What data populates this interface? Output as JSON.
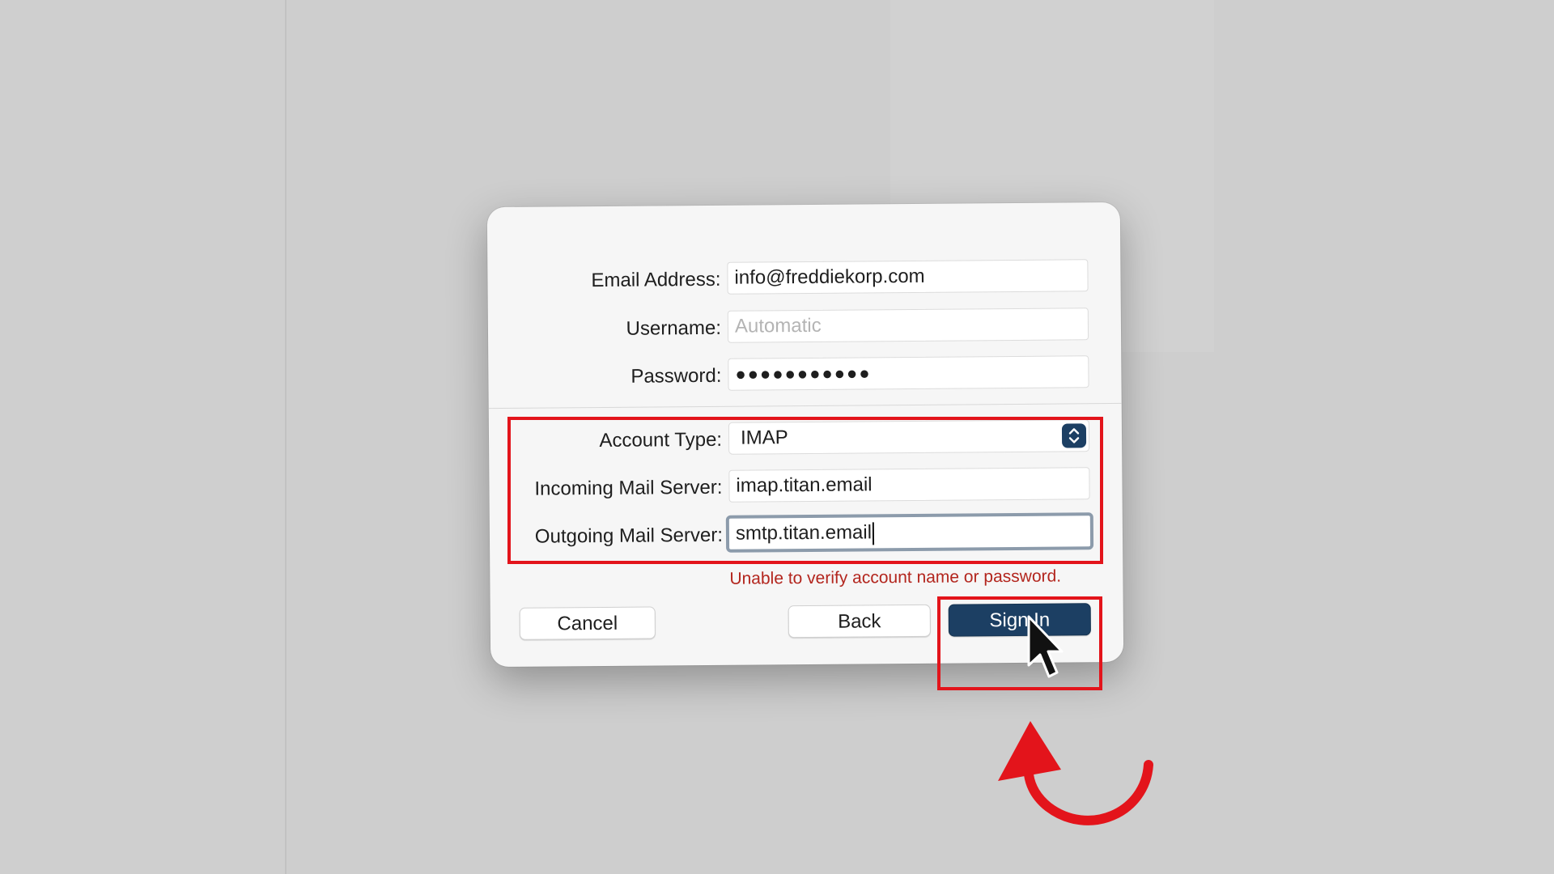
{
  "form": {
    "email_label": "Email Address:",
    "email_value": "info@freddiekorp.com",
    "username_label": "Username:",
    "username_placeholder": "Automatic",
    "password_label": "Password:",
    "password_value": "●●●●●●●●●●●",
    "account_type_label": "Account Type:",
    "account_type_value": "IMAP",
    "incoming_label": "Incoming Mail Server:",
    "incoming_value": "imap.titan.email",
    "outgoing_label": "Outgoing Mail Server:",
    "outgoing_value": "smtp.titan.email",
    "error_message": "Unable to verify account name or password."
  },
  "buttons": {
    "cancel_label": "Cancel",
    "back_label": "Back",
    "sign_in_label": "Sign In"
  },
  "icons": {
    "stepper": "chevron-up-down-icon",
    "cursor": "mouse-pointer-icon",
    "annotation": "curved-arrow-icon"
  },
  "colors": {
    "primary_button": "#1c3f63",
    "error_text": "#b3261e",
    "annotation_red": "#e3141b",
    "focus_ring": "#8c9bab"
  }
}
